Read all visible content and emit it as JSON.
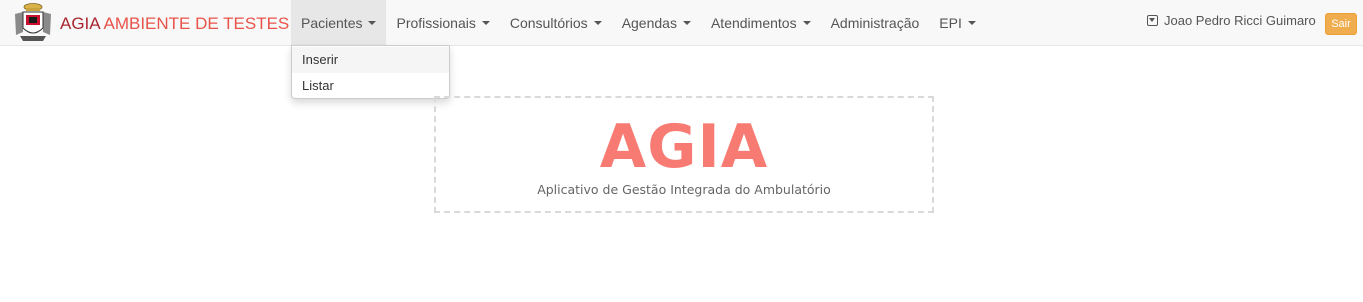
{
  "brand": {
    "part1": "AGIA",
    "part2": "AMBIENTE DE TESTES",
    "logo_icon": "coat-of-arms-logo"
  },
  "nav": {
    "items": [
      {
        "label": "Pacientes",
        "dropdown": true,
        "active": true
      },
      {
        "label": "Profissionais",
        "dropdown": true
      },
      {
        "label": "Consultórios",
        "dropdown": true
      },
      {
        "label": "Agendas",
        "dropdown": true
      },
      {
        "label": "Atendimentos",
        "dropdown": true
      },
      {
        "label": "Administração",
        "dropdown": false
      },
      {
        "label": "EPI",
        "dropdown": true
      }
    ]
  },
  "dropdown": {
    "items": [
      {
        "label": "Inserir"
      },
      {
        "label": "Listar"
      }
    ]
  },
  "user": {
    "name": "Joao Pedro Ricci Guimaro",
    "icon": "caret-square-down-icon"
  },
  "logout": {
    "label": "Sair"
  },
  "hero": {
    "title": "AGIA",
    "subtitle": "Aplicativo de Gestão Integrada do Ambulatório"
  },
  "colors": {
    "brand_dark": "#a8272f",
    "brand_light": "#e8534a",
    "hero_title": "#f77b72",
    "logout_button": "#f0ad4e",
    "navbar_bg": "#f8f8f8"
  }
}
